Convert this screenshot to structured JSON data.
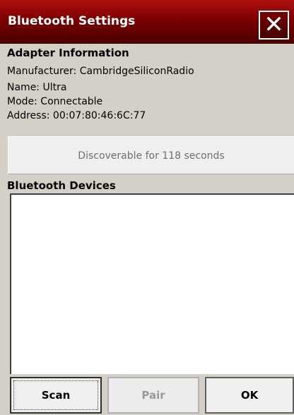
{
  "window": {
    "title": "Bluetooth Settings",
    "close_glyph": "✕"
  },
  "adapter": {
    "header": "Adapter Information",
    "manufacturer": "Manufacturer: CambridgeSiliconRadio",
    "name": "Name: Ultra",
    "mode": "Mode: Connectable",
    "address": "Address: 00:07:80:46:6C:77"
  },
  "discoverable": {
    "label": "Discoverable for 118 seconds"
  },
  "devices": {
    "header": "Bluetooth Devices",
    "items": []
  },
  "buttons": {
    "scan": "Scan",
    "pair": "Pair",
    "ok": "OK"
  },
  "colors": {
    "titlebar": "#8b0000",
    "background": "#d4d0c8",
    "disabled_text": "#9a9a9a"
  }
}
